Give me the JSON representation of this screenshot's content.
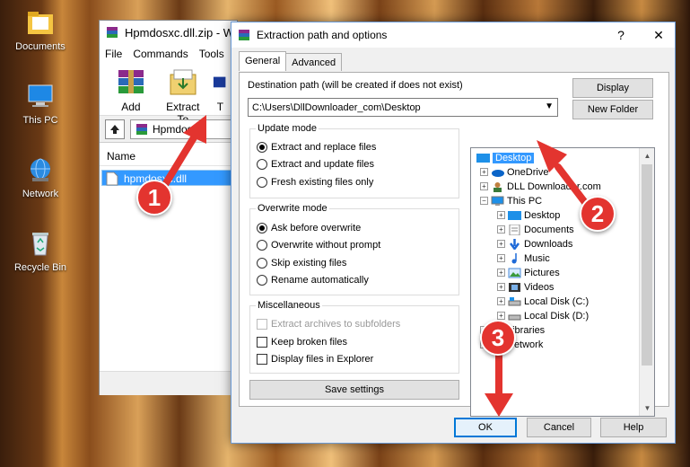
{
  "desktop": {
    "icons": [
      {
        "label": "Documents",
        "icon": "folder-documents-icon"
      },
      {
        "label": "This PC",
        "icon": "computer-icon"
      },
      {
        "label": "Network",
        "icon": "network-globe-icon"
      },
      {
        "label": "Recycle Bin",
        "icon": "recycle-bin-icon"
      }
    ]
  },
  "winrar": {
    "title": "Hpmdosxc.dll.zip - W",
    "menu": [
      "File",
      "Commands",
      "Tools"
    ],
    "toolbar": [
      {
        "label": "Add",
        "icon": "winrar-books-icon"
      },
      {
        "label": "Extract To",
        "icon": "folder-extract-icon"
      },
      {
        "label": "T",
        "icon": "test-icon"
      }
    ],
    "path": "Hpmdosxc",
    "column": "Name",
    "file": "hpmdosxc.dll"
  },
  "dialog": {
    "title": "Extraction path and options",
    "help": "?",
    "close": "✕",
    "tabs": [
      "General",
      "Advanced"
    ],
    "dest_label": "Destination path (will be created if does not exist)",
    "dest_value": "C:\\Users\\DllDownloader_com\\Desktop",
    "display_btn": "Display",
    "new_folder_btn": "New Folder",
    "update_mode": {
      "title": "Update mode",
      "options": [
        "Extract and replace files",
        "Extract and update files",
        "Fresh existing files only"
      ],
      "selected": 0
    },
    "overwrite_mode": {
      "title": "Overwrite mode",
      "options": [
        "Ask before overwrite",
        "Overwrite without prompt",
        "Skip existing files",
        "Rename automatically"
      ],
      "selected": 0
    },
    "misc": {
      "title": "Miscellaneous",
      "options": [
        "Extract archives to subfolders",
        "Keep broken files",
        "Display files in Explorer"
      ]
    },
    "save_settings": "Save settings",
    "tree": {
      "desktop": "Desktop",
      "onedrive": "OneDrive",
      "user": "DLL Downloader.com",
      "thispc": "This PC",
      "pc_items": [
        "Desktop",
        "Documents",
        "Downloads",
        "Music",
        "Pictures",
        "Videos",
        "Local Disk (C:)",
        "Local Disk (D:)"
      ],
      "libraries": "Libraries",
      "network": "Network"
    },
    "ok": "OK",
    "cancel": "Cancel",
    "help_btn": "Help"
  },
  "callouts": [
    "1",
    "2",
    "3"
  ],
  "colors": {
    "arrow": "#e3342f",
    "selection": "#3399ff",
    "accent": "#0078d7"
  }
}
